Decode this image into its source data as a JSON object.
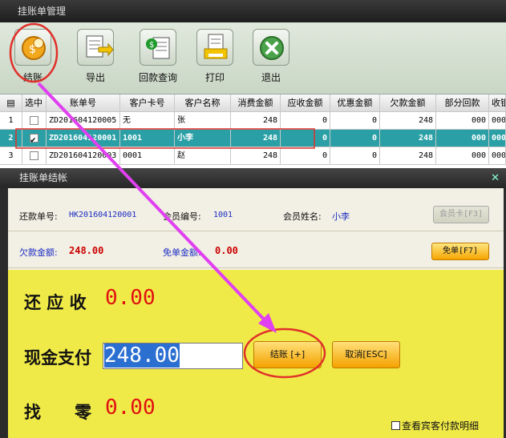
{
  "window": {
    "title": "挂账单管理"
  },
  "toolbar": {
    "items": [
      {
        "label": "结账",
        "icon": "checkout-coin-icon"
      },
      {
        "label": "导出",
        "icon": "export-icon"
      },
      {
        "label": "回款查询",
        "icon": "payment-query-icon"
      },
      {
        "label": "打印",
        "icon": "print-icon"
      },
      {
        "label": "退出",
        "icon": "exit-icon"
      }
    ]
  },
  "grid": {
    "headers": [
      "选中",
      "账单号",
      "客户卡号",
      "客户名称",
      "消费金额",
      "应收金额",
      "优惠金额",
      "欠款金额",
      "部分回款",
      "收银"
    ],
    "rows": [
      {
        "index": "1",
        "checked": false,
        "bill_no": "ZD201604120005",
        "card_no": "无",
        "name": "张",
        "consume": "248",
        "receivable": "0",
        "discount": "0",
        "debt": "248",
        "partial": "000",
        "selected": false
      },
      {
        "index": "2",
        "checked": true,
        "bill_no": "ZD201604120001",
        "card_no": "1001",
        "name": "小李",
        "consume": "248",
        "receivable": "0",
        "discount": "0",
        "debt": "248",
        "partial": "000",
        "selected": true
      },
      {
        "index": "3",
        "checked": false,
        "bill_no": "ZD201604120003",
        "card_no": "0001",
        "name": "赵",
        "consume": "248",
        "receivable": "0",
        "discount": "0",
        "debt": "248",
        "partial": "000",
        "selected": false
      }
    ]
  },
  "dialog": {
    "title": "挂账单结帐",
    "repay_label": "还款单号:",
    "repay_no": "HK201604120001",
    "member_no_label": "会员编号:",
    "member_no": "1001",
    "member_name_label": "会员姓名:",
    "member_name": "小李",
    "member_card_button": "会员卡[F3]",
    "debt_label": "欠款金额:",
    "debt_value": "248.00",
    "waive_label": "免单金额:",
    "waive_value": "0.00",
    "waive_button": "免单[F7]",
    "receivable_label": "还 应 收",
    "receivable_value": "0.00",
    "cash_label": "现金支付",
    "cash_value": "248.00",
    "checkout_button": "结账 [+]",
    "cancel_button": "取消[ESC]",
    "change_label": "找　　零",
    "change_value": "0.00",
    "detail_checkbox": "查看宾客付款明细"
  },
  "colors": {
    "selected_row": "#2aa0a6",
    "pay_panel": "#f0ea48",
    "annotation": "#e040f0",
    "highlight_circle": "#e0302a"
  }
}
